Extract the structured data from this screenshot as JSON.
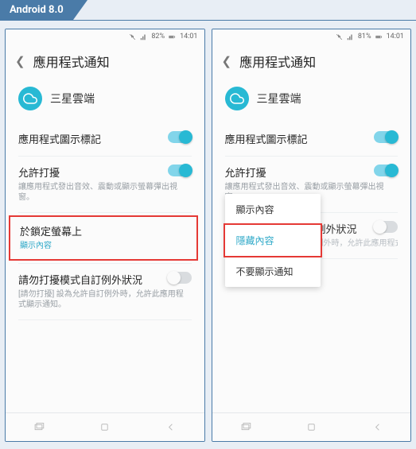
{
  "tab": "Android 8.0",
  "phones": [
    {
      "status": {
        "battery": "82%",
        "time": "14:01"
      },
      "title": "應用程式通知",
      "app": "三星雲端",
      "rows": [
        {
          "title": "應用程式圖示標記",
          "sub": null,
          "toggle": "on"
        },
        {
          "title": "允許打擾",
          "sub": "讓應用程式發出音效、震動或顯示螢幕彈出視窗。",
          "toggle": "on"
        },
        {
          "title": "於鎖定螢幕上",
          "sub": "顯示內容",
          "subBlue": true,
          "toggle": null,
          "highlight": true
        },
        {
          "title": "請勿打擾模式自訂例外狀況",
          "sub": "[請勿打擾] 設為允許自訂例外時，允許此應用程式顯示通知。",
          "toggle": "off"
        }
      ]
    },
    {
      "status": {
        "battery": "81%",
        "time": "14:01"
      },
      "title": "應用程式通知",
      "app": "三星雲端",
      "rows": [
        {
          "title": "應用程式圖示標記",
          "sub": null,
          "toggle": "on"
        },
        {
          "title": "允許打擾",
          "sub": "讓應用程式發出音效、震動或顯示螢幕彈出視窗。",
          "toggle": "on"
        },
        {
          "title": "請勿打擾模式自訂例外狀況",
          "sub": "[請勿打擾] 設為允許自訂例外時，允許此應用程式顯示通知。",
          "toggle": "off",
          "masked": true
        }
      ],
      "dropdown": {
        "items": [
          "顯示內容",
          "隱藏內容",
          "不要顯示通知"
        ],
        "highlightIndex": 1
      }
    }
  ]
}
